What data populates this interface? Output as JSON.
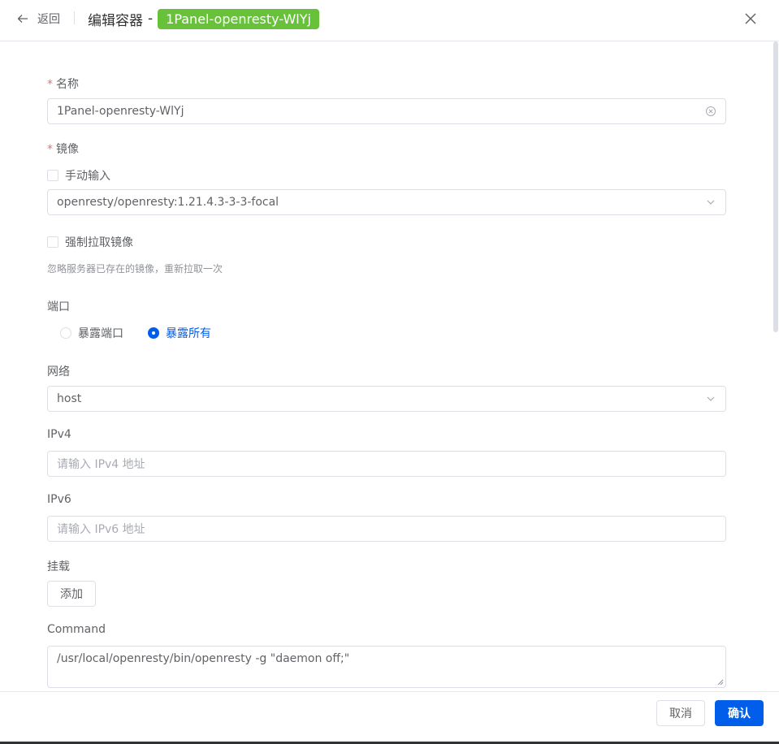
{
  "header": {
    "back_label": "返回",
    "title": "编辑容器",
    "title_separator": "-",
    "container_name_tag": "1Panel-openresty-WlYj"
  },
  "form": {
    "name": {
      "label": "名称",
      "required_mark": "*",
      "value": "1Panel-openresty-WlYj"
    },
    "image": {
      "label": "镜像",
      "required_mark": "*",
      "manual_input_label": "手动输入",
      "manual_input_checked": false,
      "selected": "openresty/openresty:1.21.4.3-3-3-focal"
    },
    "force_pull": {
      "label": "强制拉取镜像",
      "checked": false,
      "help": "忽略服务器已存在的镜像，重新拉取一次"
    },
    "ports": {
      "label": "端口",
      "options": [
        {
          "label": "暴露端口",
          "checked": false
        },
        {
          "label": "暴露所有",
          "checked": true
        }
      ]
    },
    "network": {
      "label": "网络",
      "selected": "host"
    },
    "ipv4": {
      "label": "IPv4",
      "placeholder": "请输入 IPv4 地址"
    },
    "ipv6": {
      "label": "IPv6",
      "placeholder": "请输入 IPv6 地址"
    },
    "mount": {
      "label": "挂载",
      "add_label": "添加"
    },
    "command": {
      "label": "Command",
      "value": "/usr/local/openresty/bin/openresty -g \"daemon off;\""
    }
  },
  "footer": {
    "cancel_label": "取消",
    "confirm_label": "确认"
  },
  "colors": {
    "primary": "#005eeb",
    "tag_green": "#67c23a",
    "required_red": "#f56c6c"
  }
}
